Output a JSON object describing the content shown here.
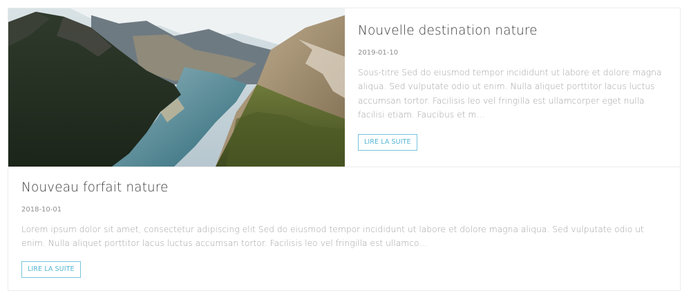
{
  "posts": [
    {
      "title": "Nouvelle destination nature",
      "date": "2019-01-10",
      "excerpt": "Sous-titre Sed do eiusmod tempor incididunt ut labore et dolore magna aliqua. Sed vulputate odio ut enim. Nulla aliquet porttitor lacus luctus accumsan tortor. Facilisis leo vel fringilla est ullamcorper eget nulla facilisi etiam. Faucibus et m...",
      "read_more": "LIRE LA SUITE",
      "image": "mountain-lake-photo"
    },
    {
      "title": "Nouveau forfait nature",
      "date": "2018-10-01",
      "excerpt": "Lorem ipsum dolor sit amet, consectetur adipiscing elit Sed do eiusmod tempor incididunt ut labore et dolore magna aliqua. Sed vulputate odio ut enim. Nulla aliquet porttitor lacus luctus accumsan tortor. Facilisis leo vel fringilla est ullamco...",
      "read_more": "LIRE LA SUITE"
    }
  ],
  "colors": {
    "accent": "#54b6d4",
    "title": "#3a3a3a",
    "text": "#a2a2a2",
    "border": "#ececec"
  }
}
